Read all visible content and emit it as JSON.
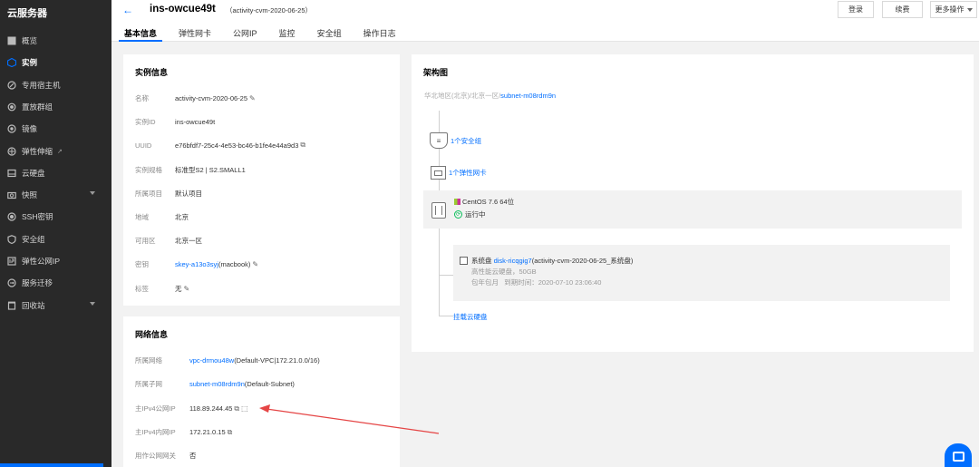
{
  "sidebar": {
    "title": "云服务器",
    "items": [
      {
        "label": "概览",
        "icon": "grid-icon"
      },
      {
        "label": "实例",
        "icon": "cube-icon",
        "active": true
      },
      {
        "label": "专用宿主机",
        "icon": "rocket-icon"
      },
      {
        "label": "置放群组",
        "icon": "gear-icon"
      },
      {
        "label": "镜像",
        "icon": "disc-icon"
      },
      {
        "label": "弹性伸缩",
        "icon": "scale-icon",
        "external": "↗"
      },
      {
        "label": "云硬盘",
        "icon": "disk-icon"
      },
      {
        "label": "快照",
        "icon": "camera-icon",
        "expandable": true
      },
      {
        "label": "SSH密钥",
        "icon": "key-icon"
      },
      {
        "label": "安全组",
        "icon": "shield-icon"
      },
      {
        "label": "弹性公网IP",
        "icon": "ip-icon"
      },
      {
        "label": "服务迁移",
        "icon": "migrate-icon"
      },
      {
        "label": "回收站",
        "icon": "trash-icon",
        "expandable": true
      }
    ]
  },
  "header": {
    "instance_id": "ins-owcue49t",
    "instance_name": "（activity-cvm-2020-06-25）",
    "login_label": "登录",
    "renew_label": "续费",
    "more_label": "更多操作"
  },
  "tabs": [
    "基本信息",
    "弹性网卡",
    "公网IP",
    "监控",
    "安全组",
    "操作日志"
  ],
  "instance_info": {
    "title": "实例信息",
    "rows": [
      {
        "label": "名称",
        "value": "activity-cvm-2020-06-25"
      },
      {
        "label": "实例ID",
        "value": "ins-owcue49t"
      },
      {
        "label": "UUID",
        "value": "e76bfdf7-25c4-4e53-bc46-b1fe4e44a9d3"
      },
      {
        "label": "实例规格",
        "value": "标准型S2 | S2.SMALL1"
      },
      {
        "label": "所属项目",
        "value": "默认项目"
      },
      {
        "label": "地域",
        "value": "北京"
      },
      {
        "label": "可用区",
        "value": "北京一区"
      },
      {
        "label": "密钥",
        "value_link": "skey-a13o3syj",
        "value_tail": "(macbook)"
      },
      {
        "label": "标签",
        "value": "无"
      }
    ]
  },
  "network_info": {
    "title": "网络信息",
    "rows": [
      {
        "label": "所属网络",
        "value_link": "vpc-drmou48w",
        "value_tail": "(Default-VPC|172.21.0.0/16)"
      },
      {
        "label": "所属子网",
        "value_link": "subnet-m08rdm9n",
        "value_tail": "(Default-Subnet)"
      },
      {
        "label": "主IPv4公网IP",
        "value": "118.89.244.45"
      },
      {
        "label": "主IPv4内网IP",
        "value": "172.21.0.15"
      },
      {
        "label": "用作公网网关",
        "value": "否"
      }
    ]
  },
  "architecture": {
    "title": "架构图",
    "region": "华北地区(北京)/北京一区/",
    "subnet": "subnet-m08rdm9n",
    "security_group": "1个安全组",
    "eni": "1个弹性网卡",
    "os": "CentOS 7.6 64位",
    "status": "运行中",
    "disk_prefix": "系统盘 ",
    "disk_id": "disk-ricqgig7",
    "disk_name": "(activity-cvm-2020-06-25_系统盘)",
    "disk_spec": "高性能云硬盘，50GB",
    "disk_billing": "包年包月   到期时间：2020-07-10 23:06:40",
    "mount": "挂载云硬盘"
  },
  "colors": {
    "accent": "#006eff",
    "sidebar_bg": "#292929",
    "running": "#0abf5b",
    "arrow": "#e54545"
  }
}
